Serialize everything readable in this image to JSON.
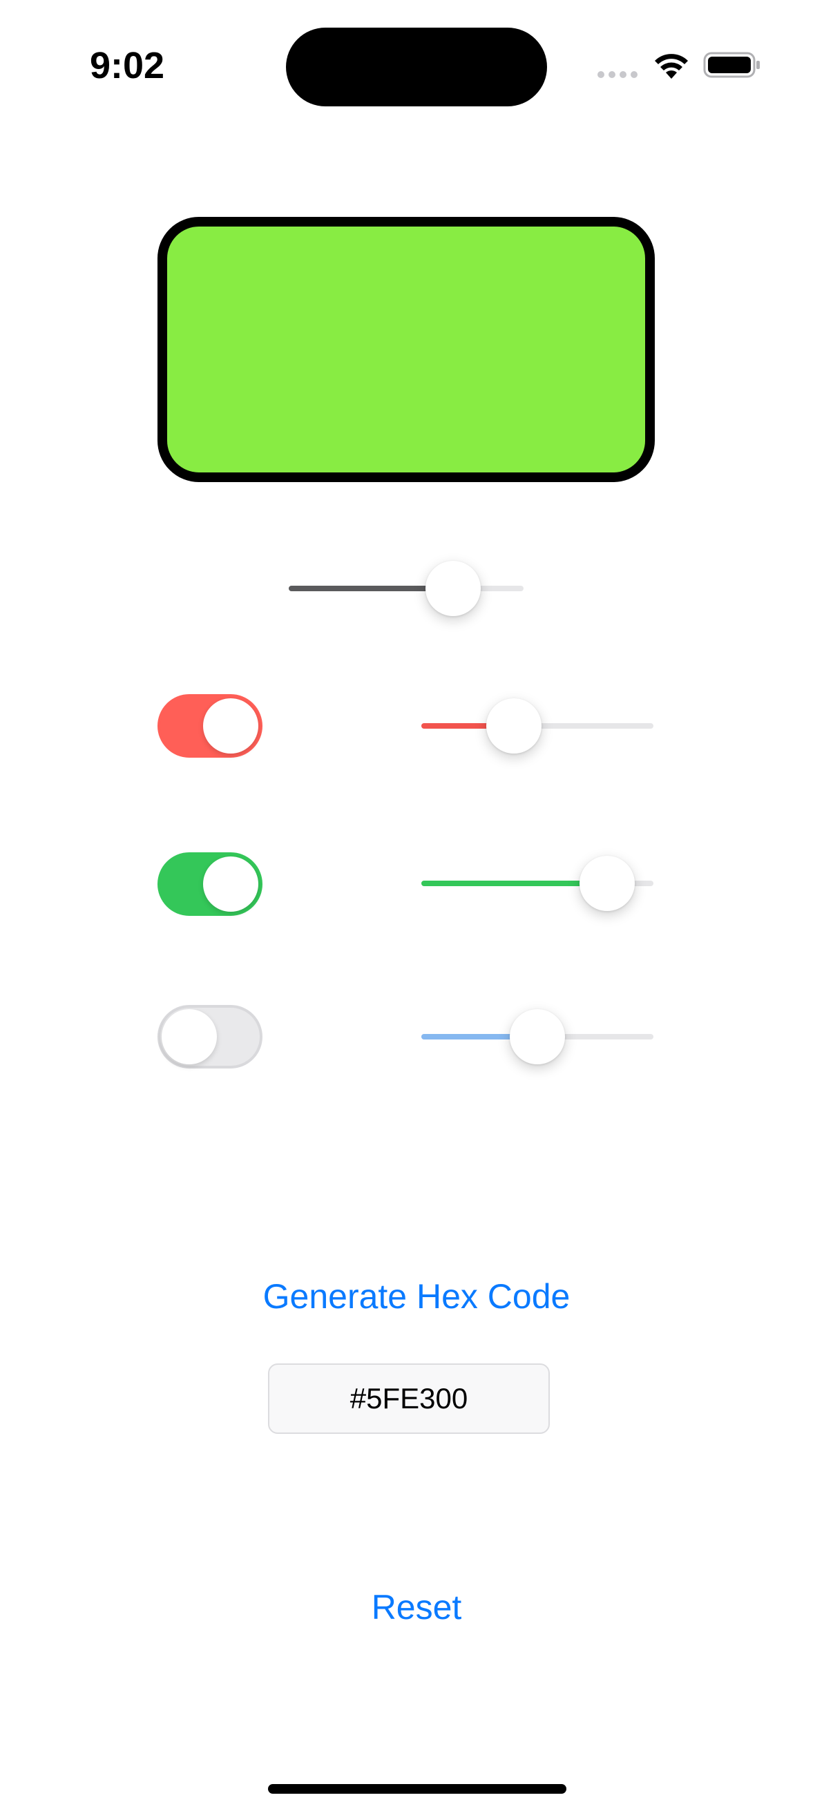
{
  "status_bar": {
    "time": "9:02",
    "icons": [
      "cellular-signal-icon",
      "wifi-icon",
      "battery-icon"
    ]
  },
  "preview": {
    "color": "#88EC43",
    "border_color": "#000000"
  },
  "brightness_slider": {
    "value": 0.7,
    "fill_color": "#5a5a5c"
  },
  "channels": [
    {
      "name": "red",
      "enabled": true,
      "toggle_color": "#FF5F57",
      "slider_color": "#F2544E",
      "value": 0.4
    },
    {
      "name": "green",
      "enabled": true,
      "toggle_color": "#34C759",
      "slider_color": "#34C759",
      "value": 0.8
    },
    {
      "name": "blue",
      "enabled": false,
      "toggle_color": "#E9E9EB",
      "slider_color": "#86B8F0",
      "value": 0.5
    }
  ],
  "generate_button": {
    "label": "Generate Hex Code"
  },
  "hex_output": {
    "value": "#5FE300"
  },
  "reset_button": {
    "label": "Reset"
  },
  "accent_color": "#0A7AFF"
}
